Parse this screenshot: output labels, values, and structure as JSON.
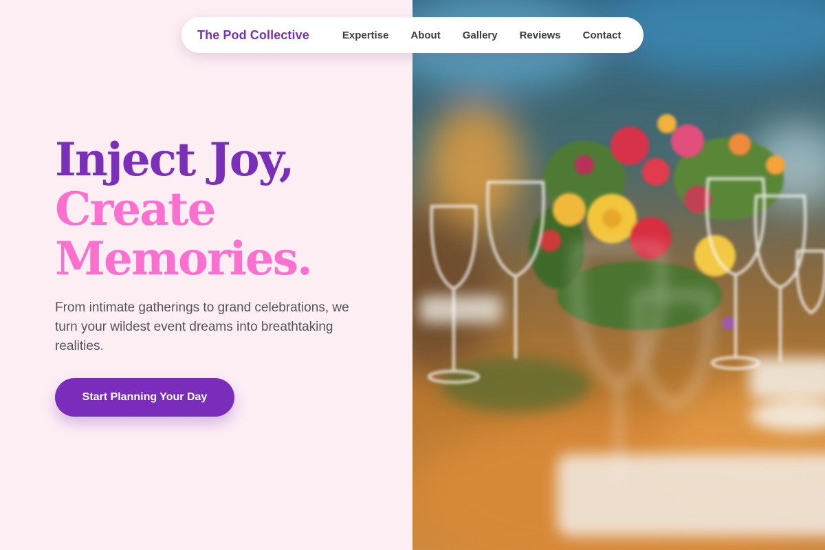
{
  "nav": {
    "brand": "The Pod Collective",
    "links": [
      "Expertise",
      "About",
      "Gallery",
      "Reviews",
      "Contact"
    ]
  },
  "hero": {
    "title_line1": "Inject Joy,",
    "title_line2": "Create",
    "title_line3": "Memories.",
    "subtitle": "From intimate gatherings to grand celebrations, we turn your wildest event dreams into breathtaking realities.",
    "cta_label": "Start Planning Your Day"
  },
  "colors": {
    "brand_purple": "#7a2fb8",
    "accent_pink": "#fb6fce",
    "page_background": "#fdeef4",
    "button": "#7a2dbb"
  }
}
